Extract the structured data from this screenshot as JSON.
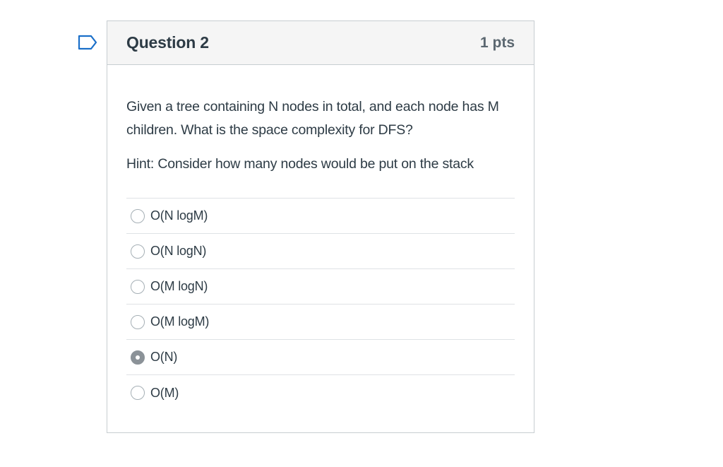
{
  "question": {
    "title": "Question 2",
    "points": "1 pts",
    "text": "Given a tree containing N nodes in total, and each node has M children. What is the space complexity for DFS?",
    "hint": "Hint: Consider how many nodes would be put on the stack",
    "flag_icon": "bookmark-flag-icon",
    "answers": [
      {
        "label": "O(N logM)",
        "selected": false
      },
      {
        "label": "O(N logN)",
        "selected": false
      },
      {
        "label": "O(M logN)",
        "selected": false
      },
      {
        "label": "O(M logM)",
        "selected": false
      },
      {
        "label": "O(N)",
        "selected": true
      },
      {
        "label": "O(M)",
        "selected": false
      }
    ]
  },
  "colors": {
    "header_bg": "#f5f5f5",
    "border": "#c7cdd1",
    "text": "#2d3b45",
    "flag": "#1a6fc9",
    "radio_selected": "#8b9298"
  }
}
